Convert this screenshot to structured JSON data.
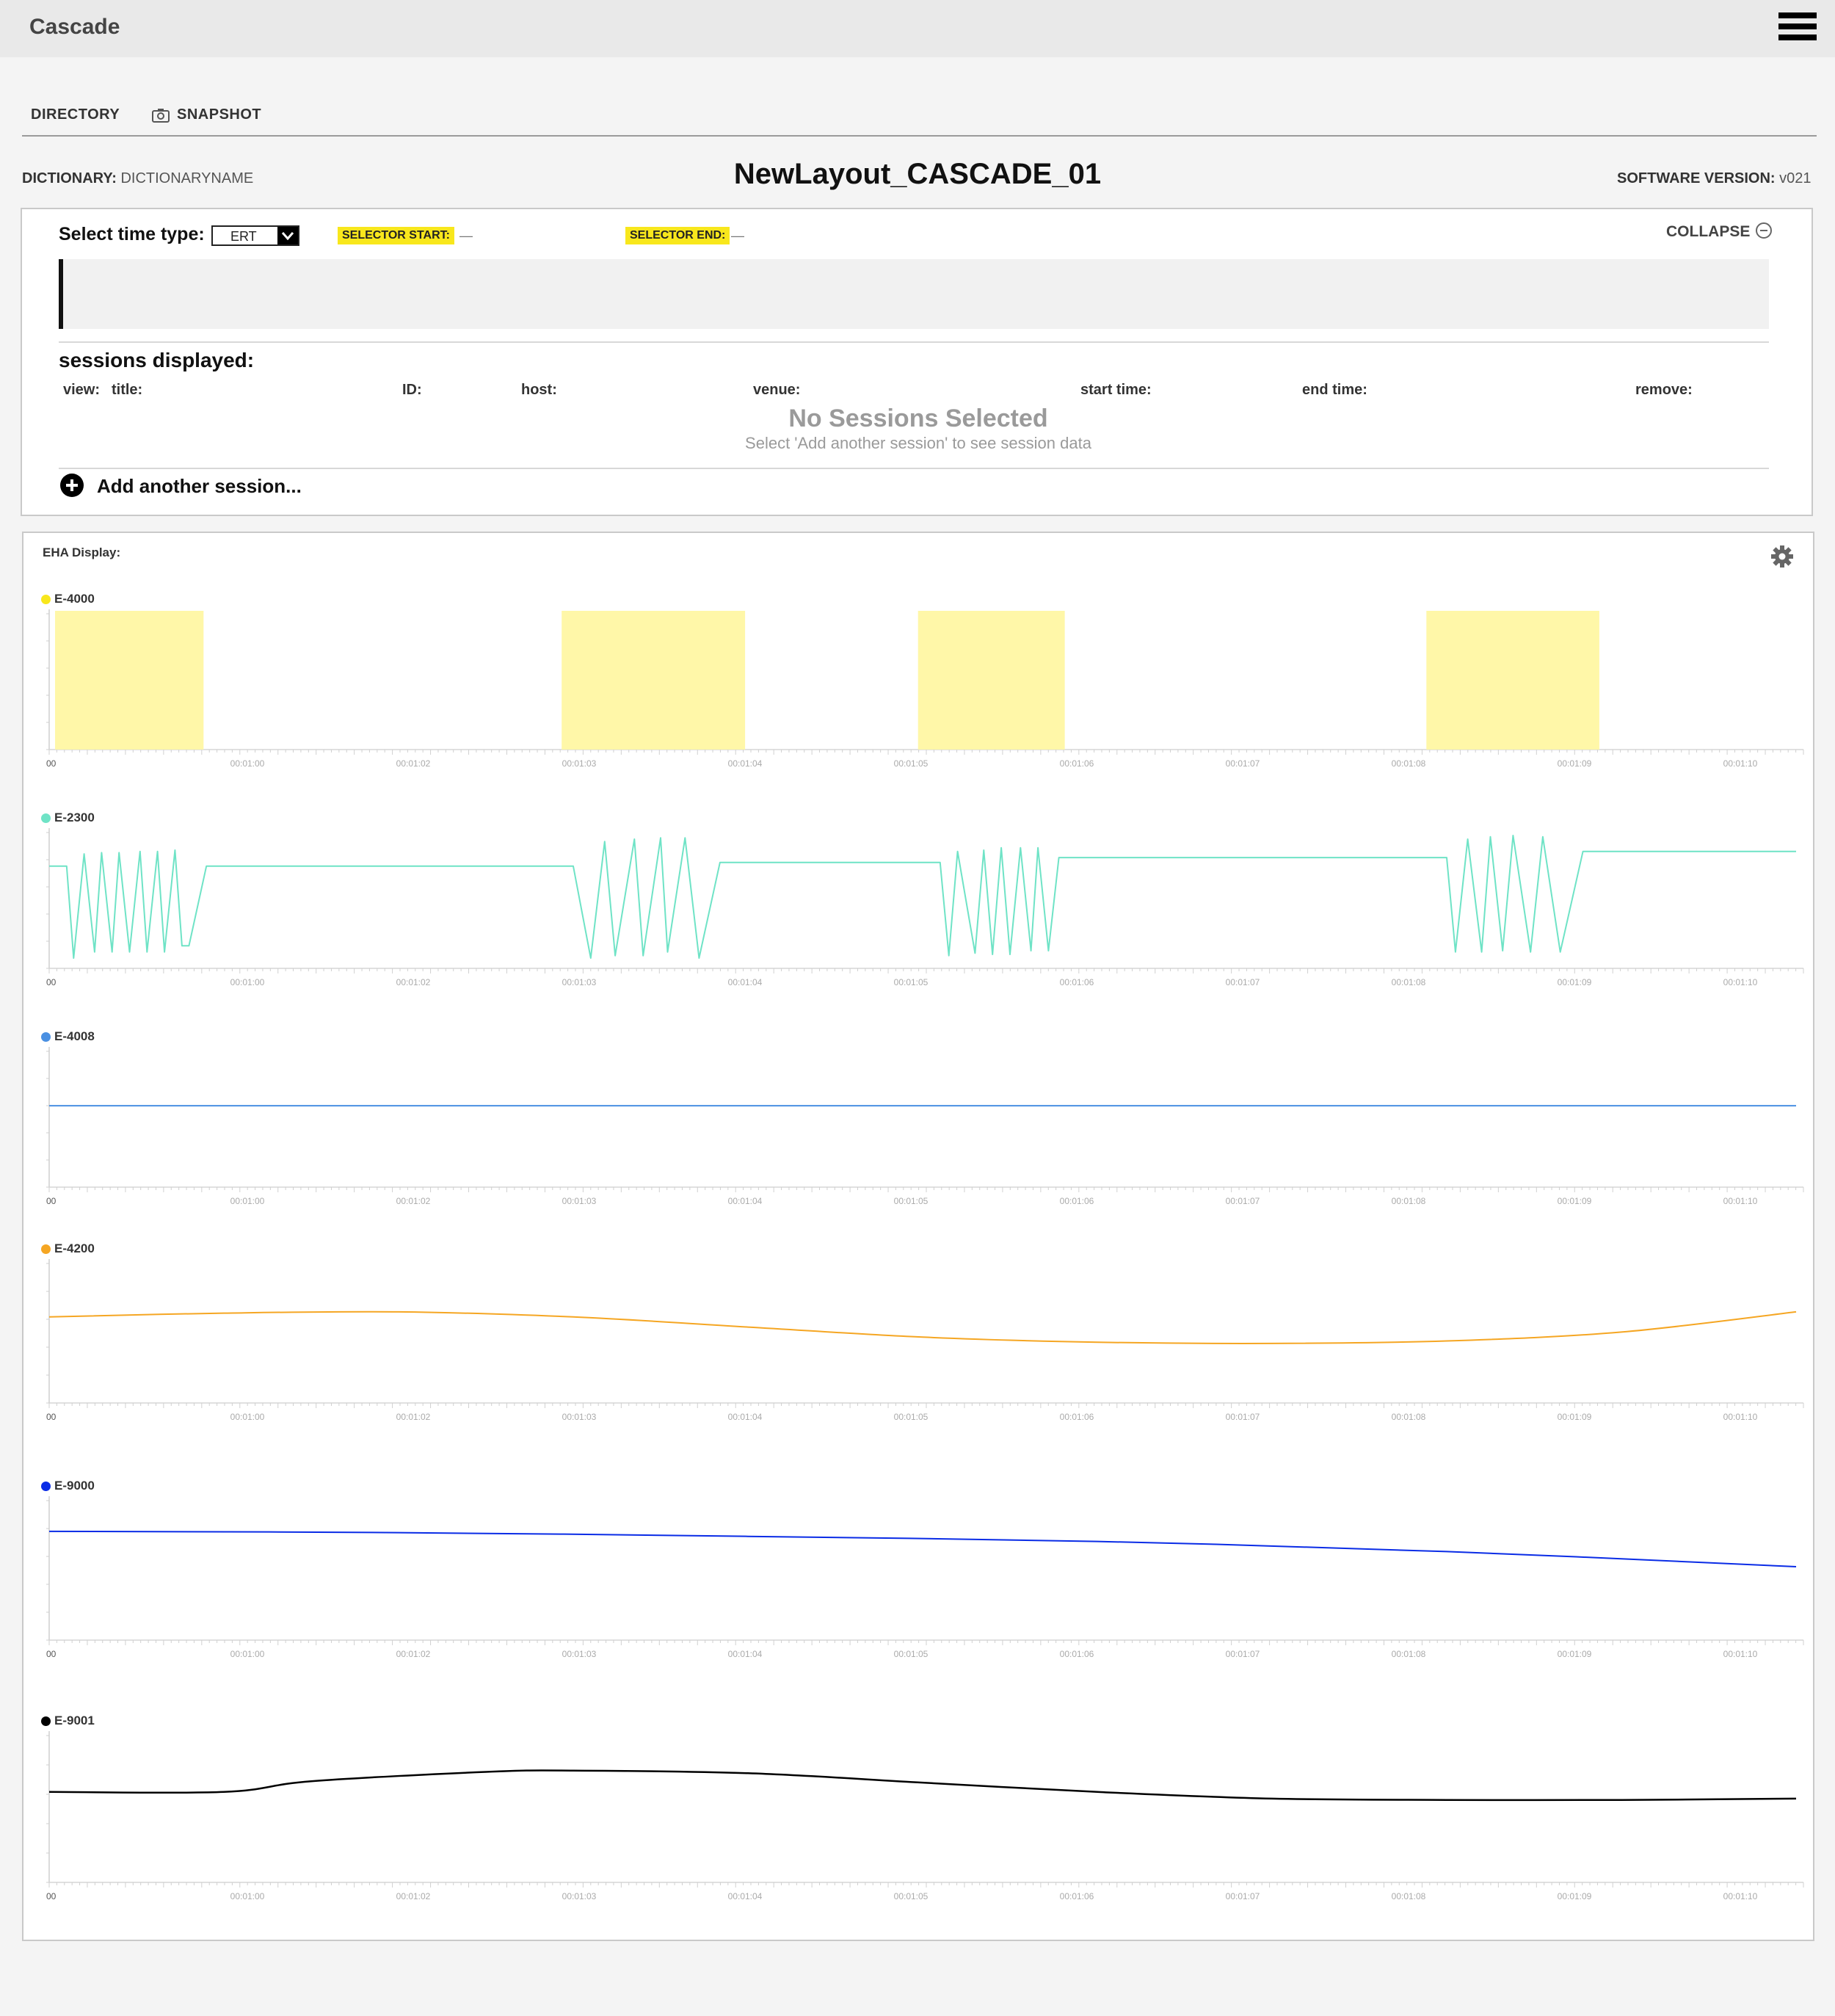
{
  "app": {
    "title": "Cascade"
  },
  "nav": {
    "directory": "DIRECTORY",
    "snapshot": "SNAPSHOT"
  },
  "meta": {
    "dictionary_label": "DICTIONARY:",
    "dictionary_value": "DICTIONARYNAME",
    "layout_name": "NewLayout_CASCADE_01",
    "software_label": "SOFTWARE VERSION:",
    "software_value": "v021"
  },
  "controls": {
    "time_type_label": "Select time type:",
    "time_type_value": "ERT",
    "selector_start_label": "SELECTOR START:",
    "selector_start_value": "—",
    "selector_end_label": "SELECTOR END:",
    "selector_end_value": "—",
    "collapse_label": "COLLAPSE"
  },
  "sessions": {
    "title": "sessions displayed:",
    "columns": [
      "view:",
      "title:",
      "ID:",
      "host:",
      "venue:",
      "start time:",
      "end time:",
      "remove:"
    ],
    "empty_title": "No Sessions Selected",
    "empty_subtitle": "Select 'Add another session' to see session data",
    "add_label": "Add another session..."
  },
  "eha": {
    "title": "EHA Display:"
  },
  "chart_data": [
    {
      "type": "bar",
      "name": "E-4000",
      "color": "#fff7a8",
      "dot": "#f8e71c",
      "x_ticks": [
        "00",
        "00:01:00",
        "00:01:02",
        "00:01:03",
        "00:01:04",
        "00:01:05",
        "00:01:06",
        "00:01:07",
        "00:01:08",
        "00:01:09",
        "00:01:10"
      ],
      "intervals": [
        [
          0.0,
          0.085
        ],
        [
          0.29,
          0.395
        ],
        [
          0.494,
          0.578
        ],
        [
          0.785,
          0.884
        ]
      ]
    },
    {
      "type": "line",
      "name": "E-2300",
      "color": "#6fe3c6",
      "x_ticks": [
        "00",
        "00:01:00",
        "00:01:02",
        "00:01:03",
        "00:01:04",
        "00:01:05",
        "00:01:06",
        "00:01:07",
        "00:01:08",
        "00:01:09",
        "00:01:10"
      ],
      "x": [
        0.0,
        0.01,
        0.014,
        0.02,
        0.026,
        0.03,
        0.036,
        0.04,
        0.046,
        0.052,
        0.056,
        0.062,
        0.066,
        0.072,
        0.076,
        0.08,
        0.09,
        0.3,
        0.31,
        0.318,
        0.324,
        0.335,
        0.34,
        0.35,
        0.354,
        0.364,
        0.372,
        0.384,
        0.394,
        0.5,
        0.51,
        0.515,
        0.52,
        0.53,
        0.535,
        0.54,
        0.545,
        0.55,
        0.556,
        0.562,
        0.566,
        0.572,
        0.578,
        0.585,
        0.6,
        0.8,
        0.805,
        0.812,
        0.82,
        0.825,
        0.832,
        0.838,
        0.848,
        0.855,
        0.865,
        0.878,
        0.89,
        1.0
      ],
      "y": [
        0.75,
        0.75,
        0.0,
        0.85,
        0.05,
        0.86,
        0.05,
        0.86,
        0.05,
        0.87,
        0.05,
        0.87,
        0.05,
        0.88,
        0.1,
        0.1,
        0.75,
        0.75,
        0.0,
        0.95,
        0.02,
        0.97,
        0.02,
        0.98,
        0.05,
        0.98,
        0.0,
        0.78,
        0.78,
        0.78,
        0.78,
        0.02,
        0.87,
        0.04,
        0.88,
        0.03,
        0.9,
        0.03,
        0.9,
        0.06,
        0.9,
        0.06,
        0.82,
        0.82,
        0.82,
        0.82,
        0.05,
        0.97,
        0.05,
        0.99,
        0.06,
        1.0,
        0.05,
        0.99,
        0.05,
        0.87,
        0.87,
        0.87
      ]
    },
    {
      "type": "line",
      "name": "E-4008",
      "color": "#4a90e2",
      "x_ticks": [
        "00",
        "00:01:00",
        "00:01:02",
        "00:01:03",
        "00:01:04",
        "00:01:05",
        "00:01:06",
        "00:01:07",
        "00:01:08",
        "00:01:09",
        "00:01:10"
      ],
      "x": [
        0.0,
        1.0
      ],
      "y": [
        0.58,
        0.58
      ]
    },
    {
      "type": "line",
      "name": "E-4200",
      "color": "#f5a623",
      "x_ticks": [
        "00",
        "00:01:00",
        "00:01:02",
        "00:01:03",
        "00:01:04",
        "00:01:05",
        "00:01:06",
        "00:01:07",
        "00:01:08",
        "00:01:09",
        "00:01:10"
      ],
      "x": [
        0.0,
        0.1,
        0.2,
        0.3,
        0.4,
        0.5,
        0.6,
        0.7,
        0.8,
        0.9,
        1.0
      ],
      "y": [
        0.6,
        0.63,
        0.64,
        0.6,
        0.52,
        0.44,
        0.4,
        0.39,
        0.41,
        0.48,
        0.64
      ]
    },
    {
      "type": "line",
      "name": "E-9000",
      "color": "#0a2ce6",
      "x_ticks": [
        "00",
        "00:01:00",
        "00:01:02",
        "00:01:03",
        "00:01:04",
        "00:01:05",
        "00:01:06",
        "00:01:07",
        "00:01:08",
        "00:01:09",
        "00:01:10"
      ],
      "x": [
        0.0,
        0.2,
        0.4,
        0.6,
        0.8,
        1.0
      ],
      "y": [
        0.78,
        0.77,
        0.74,
        0.7,
        0.62,
        0.5
      ]
    },
    {
      "type": "line",
      "name": "E-9001",
      "color": "#000000",
      "x_ticks": [
        "00",
        "00:01:00",
        "00:01:02",
        "00:01:03",
        "00:01:04",
        "00:01:05",
        "00:01:06",
        "00:01:07",
        "00:01:08",
        "00:01:09",
        "00:01:10"
      ],
      "x": [
        0.0,
        0.1,
        0.15,
        0.25,
        0.3,
        0.4,
        0.5,
        0.6,
        0.7,
        0.8,
        0.9,
        1.0
      ],
      "y": [
        0.6,
        0.6,
        0.68,
        0.75,
        0.76,
        0.74,
        0.67,
        0.6,
        0.55,
        0.54,
        0.54,
        0.55
      ]
    }
  ]
}
